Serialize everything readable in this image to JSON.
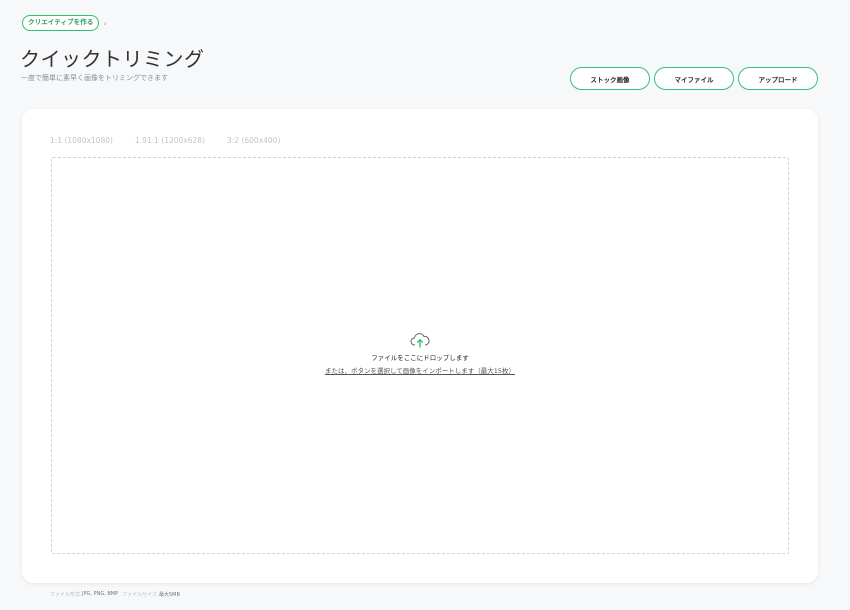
{
  "breadcrumb": {
    "items": [
      "クリエイティブを作る"
    ],
    "separator": "›"
  },
  "header": {
    "title": "クイックトリミング",
    "subtitle": "一度で簡単に素早く画像をトリミングできます"
  },
  "actions": {
    "stock": "ストック画像",
    "my_files": "マイファイル",
    "upload": "アップロード"
  },
  "ratio_tabs": [
    "1:1 (1080x1080)",
    "1.91:1 (1200x628)",
    "3:2 (600x400)"
  ],
  "dropzone": {
    "icon": "cloud-upload-icon",
    "title": "ファイルをここにドロップします",
    "link": "または、ボタンを選択して画像をインポートします（最大15枚）"
  },
  "footer": {
    "format_label": "ファイル形式",
    "format_value": "JPG, PNG, BMP",
    "size_label": "ファイルサイズ",
    "size_value": "最大5MB"
  },
  "colors": {
    "accent": "#35c07a",
    "background": "#f7f8fa",
    "card": "#ffffff"
  }
}
